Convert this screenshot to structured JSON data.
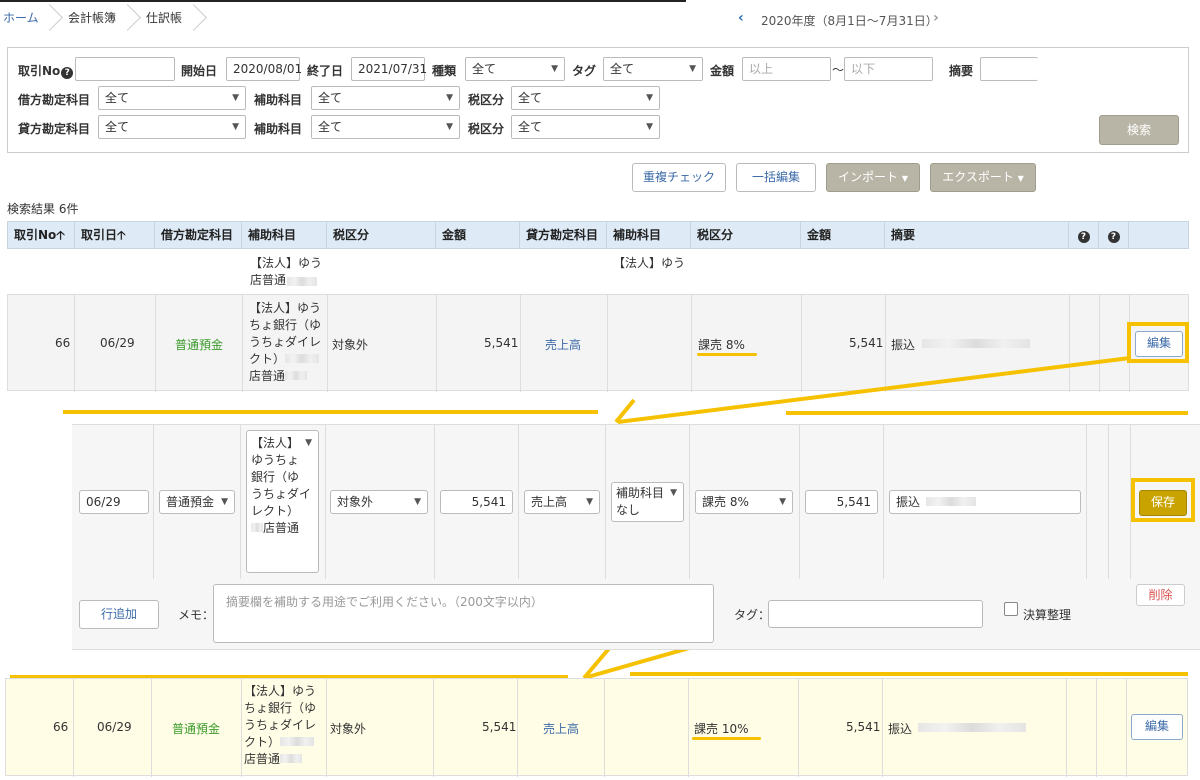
{
  "breadcrumb": {
    "home": "ホーム",
    "books": "会計帳簿",
    "journal": "仕訳帳"
  },
  "fiscal_year": "2020年度（8月1日〜7月31日）",
  "search": {
    "txn_no_label": "取引No",
    "start_label": "開始日",
    "start_value": "2020/08/01",
    "end_label": "終了日",
    "end_value": "2021/07/31",
    "type_label": "種類",
    "type_value": "全て",
    "tag_label": "タグ",
    "tag_value": "全て",
    "amount_label": "金額",
    "amount_min_ph": "以上",
    "tilde": "〜",
    "amount_max_ph": "以下",
    "memo_label": "摘要",
    "debit_label": "借方勘定科目",
    "credit_label": "貸方勘定科目",
    "sub_label": "補助科目",
    "tax_label": "税区分",
    "all": "全て",
    "search_button": "検索"
  },
  "actions": {
    "dup_check": "重複チェック",
    "bulk_edit": "一括編集",
    "import": "インポート",
    "export": "エクスポート"
  },
  "results_count": "検索結果 6件",
  "columns": [
    "取引No",
    "取引日",
    "借方勘定科目",
    "補助科目",
    "税区分",
    "金額",
    "貸方勘定科目",
    "補助科目",
    "税区分",
    "金額",
    "摘要"
  ],
  "partial_row": {
    "sub1": "【法人】ゆう",
    "sub1b": "店普通",
    "sub2": "【法人】ゆう"
  },
  "row_before": {
    "no": "66",
    "date": "06/29",
    "debit": "普通預金",
    "sub_lines": [
      "【法人】ゆう",
      "ちょ銀行（ゆ",
      "うちょダイレ",
      "クト）",
      "店普通"
    ],
    "tax": "対象外",
    "amount": "5,541",
    "credit": "売上高",
    "credit_tax": "課売 8%",
    "credit_amount": "5,541",
    "memo": "振込",
    "edit": "編集"
  },
  "edit_row": {
    "date": "06/29",
    "debit": "普通預金",
    "sub_lines": [
      "【法人】",
      "ゆうちょ",
      "銀行（ゆ",
      "うちょダイ",
      "レクト）",
      "店普通"
    ],
    "tax": "対象外",
    "amount": "5,541",
    "credit": "売上高",
    "credit_sub_l1": "補助科目",
    "credit_sub_l2": "なし",
    "credit_tax": "課売 8%",
    "credit_amount": "5,541",
    "memo": "振込",
    "save": "保存",
    "add_row": "行追加",
    "memo_label": "メモ：",
    "memo_ph": "摘要欄を補助する用途でご利用ください。（200文字以内）",
    "tag_label": "タグ：",
    "settle": "決算整理",
    "delete": "削除"
  },
  "row_after": {
    "no": "66",
    "date": "06/29",
    "debit": "普通預金",
    "sub_lines": [
      "【法人】ゆう",
      "ちょ銀行（ゆ",
      "うちょダイレ",
      "クト）",
      "店普通"
    ],
    "tax": "対象外",
    "amount": "5,541",
    "credit": "売上高",
    "credit_tax": "課売 10%",
    "credit_amount": "5,541",
    "memo": "振込",
    "edit": "編集"
  },
  "colors": {
    "highlight": "#f5c100",
    "header_bg": "#deeaf6",
    "row_yellow": "#fffde6"
  }
}
